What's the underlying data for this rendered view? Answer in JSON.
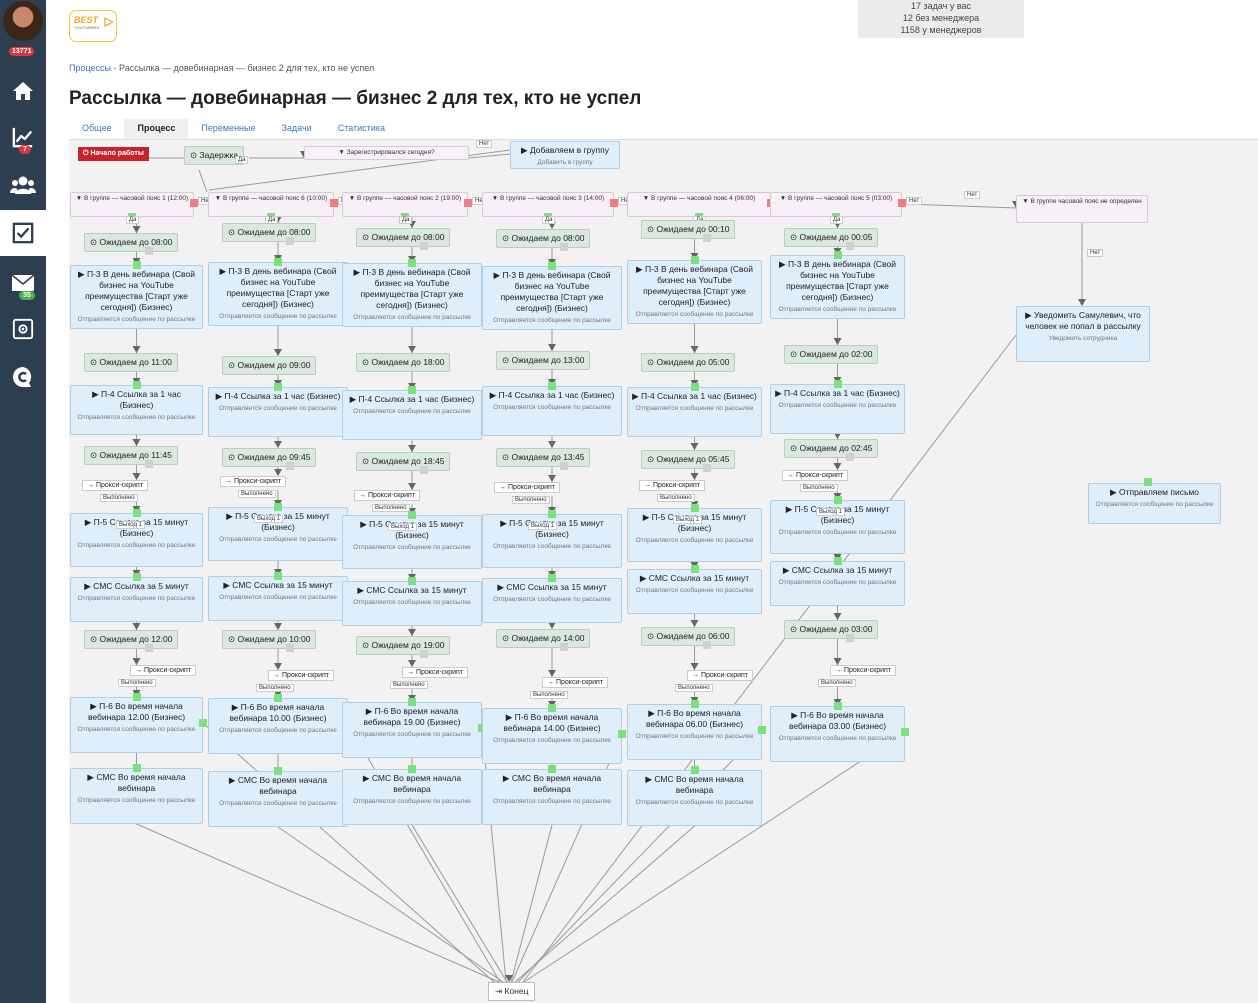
{
  "sidebar": {
    "badge_top": "13771",
    "items": [
      {
        "icon": "home-icon",
        "badge": ""
      },
      {
        "icon": "chart-icon",
        "badge": "7",
        "badge_color": "#d9363e"
      },
      {
        "icon": "users-icon",
        "badge": ""
      },
      {
        "icon": "tasks-icon",
        "badge": "",
        "active": true
      },
      {
        "icon": "mail-icon",
        "badge": "35",
        "badge_color": "#4caf50"
      },
      {
        "icon": "settings-icon",
        "badge": ""
      },
      {
        "icon": "chat-icon",
        "badge": ""
      }
    ]
  },
  "logo": {
    "text": "BEST",
    "sub": "YOUTUBERS"
  },
  "stats": {
    "line1": "17 задач у вас",
    "line2": "12 без менеджера",
    "line3": "1158 у менеджеров"
  },
  "breadcrumb": {
    "root": "Процессы",
    "sep": " - ",
    "current": "Рассылка — довебинарная — бизнес 2 для тех, кто не успел"
  },
  "page_title": "Рассылка — довебинарная — бизнес 2 для тех, кто не успел",
  "tabs": [
    "Общее",
    "Процесс",
    "Переменные",
    "Задачи",
    "Статистика"
  ],
  "active_tab": 1,
  "process": {
    "start": "Начало работы",
    "delay": "Задержка",
    "registered_cond": "Зарегистрировался сегодня?",
    "add_group": {
      "title": "Добавляем в группу",
      "sub": "Добавить в группу"
    },
    "end": "Конец",
    "labels": {
      "yes": "Да",
      "no": "Нет",
      "done": "Выполнено",
      "exit": "Выход 1",
      "proxy": "Прокси-скрипт"
    },
    "tz_undefined": "В группе часовой пояс не определен",
    "notify": {
      "title": "Уведомить Самулевич, что человек не попал в рассылку",
      "sub": "Уведомить сотрудника"
    },
    "send_letter": {
      "title": "Отправляем письмо",
      "sub": "Отправляется сообщение по рассылке"
    },
    "send_sub": "Отправляется сообщение по рассылке",
    "columns": [
      {
        "cond": "В группе — часовой пояс 1 (12:00)",
        "w1": "Ожидаем до 08:00",
        "p3": "П-3 В день вебинара (Свой бизнес на YouTube преимущества [Старт уже сегодня]) (Бизнес)",
        "w2": "Ожидаем до 11:00",
        "p4": "П-4 Ссылка за 1 час (Бизнес)",
        "w3": "Ожидаем до 11:45",
        "p5": "П-5 Ссылка за 15 минут (Бизнес)",
        "sms15": "СМС Ссылка за 5 минут",
        "w4": "Ожидаем до 12:00",
        "p6": "П-6 Во время начала вебинара 12.00 (Бизнес)",
        "sms": "СМС Во время начала вебинара"
      },
      {
        "cond": "В группе — часовой пояс 6 (10:00)",
        "w1": "Ожидаем до 08:00",
        "p3": "П-3 В день вебинара (Свой бизнес на YouTube преимущества [Старт уже сегодня]) (Бизнес)",
        "w2": "Ожидаем до 09:00",
        "p4": "П-4 Ссылка за 1 час (Бизнес)",
        "w3": "Ожидаем до 09:45",
        "p5": "П-5 Ссылка за 15 минут (Бизнес)",
        "sms15": "СМС Ссылка за 15 минут",
        "w4": "Ожидаем до 10:00",
        "p6": "П-6 Во время начала вебинара 10.00 (Бизнес)",
        "sms": "СМС Во время начала вебинара"
      },
      {
        "cond": "В группе — часовой пояс 2 (19:00)",
        "w1": "Ожидаем до 08:00",
        "p3": "П-3 В день вебинара (Свой бизнес на YouTube преимущества [Старт уже сегодня]) (Бизнес)",
        "w2": "Ожидаем до 18:00",
        "p4": "П-4 Ссылка за 1 час (Бизнес)",
        "w3": "Ожидаем до 18:45",
        "p5": "П-5 Ссылка за 15 минут (Бизнес)",
        "sms15": "СМС Ссылка за 15 минут",
        "w4": "Ожидаем до 19:00",
        "p6": "П-6 Во время начала вебинара 19.00 (Бизнес)",
        "sms": "СМС Во время начала вебинара"
      },
      {
        "cond": "В группе — часовой пояс 3 (14:00)",
        "w1": "Ожидаем до 08:00",
        "p3": "П-3 В день вебинара (Свой бизнес на YouTube преимущества [Старт уже сегодня]) (Бизнес)",
        "w2": "Ожидаем до 13:00",
        "p4": "П-4 Ссылка за 1 час (Бизнес)",
        "w3": "Ожидаем до 13:45",
        "p5": "П-5 Ссылка за 15 минут (Бизнес)",
        "sms15": "СМС Ссылка за 15 минут",
        "w4": "Ожидаем до 14:00",
        "p6": "П-6 Во время начала вебинара 14.00 (Бизнес)",
        "sms": "СМС Во время начала вебинара"
      },
      {
        "cond": "В группе — часовой пояс 4 (06:00)",
        "w1": "Ожидаем до 00:10",
        "p3": "П-3 В день вебинара (Свой бизнес на YouTube преимущества [Старт уже сегодня]) (Бизнес)",
        "w2": "Ожидаем до 05:00",
        "p4": "П-4 Ссылка за 1 час (Бизнес)",
        "w3": "Ожидаем до 05:45",
        "p5": "П-5 Ссылка за 15 минут (Бизнес)",
        "sms15": "СМС Ссылка за 15 минут",
        "w4": "Ожидаем до 06:00",
        "p6": "П-6 Во время начала вебинара 06.00 (Бизнес)",
        "sms": "СМС Во время начала вебинара"
      },
      {
        "cond": "В группе — часовой пояс 5 (03:00)",
        "w1": "Ожидаем до 00:05",
        "p3": "П-3 В день вебинара (Свой бизнес на YouTube преимущества [Старт уже сегодня]) (Бизнес)",
        "w2": "Ожидаем до 02:00",
        "p4": "П-4 Ссылка за 1 час (Бизнес)",
        "w3": "Ожидаем до 02:45",
        "p5": "П-5 Ссылка за 15 минут (Бизнес)",
        "sms15": "СМС Ссылка за 15 минут",
        "w4": "Ожидаем до 03:00",
        "p6": "П-6 Во время начала вебинара 03.00 (Бизнес)",
        "sms": ""
      }
    ]
  }
}
